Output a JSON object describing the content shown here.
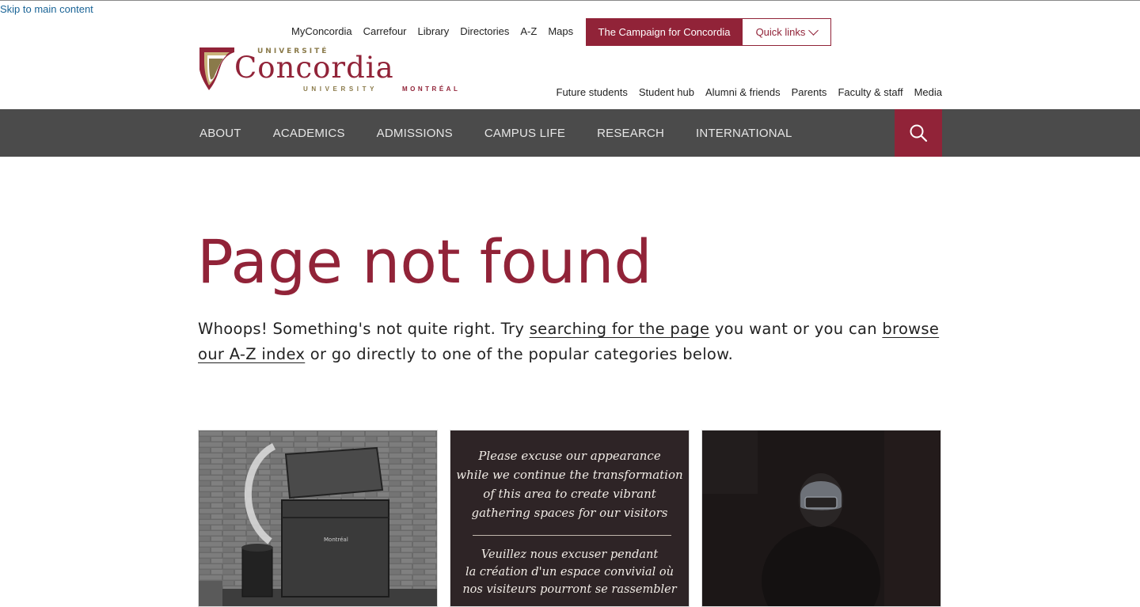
{
  "skip_link": "Skip to main content",
  "utility_nav": [
    "MyConcordia",
    "Carrefour",
    "Library",
    "Directories",
    "A-Z",
    "Maps"
  ],
  "campaign_button": "The Campaign for Concordia",
  "quick_links": "Quick links",
  "logo": {
    "univ_fr": "UNIVERSITÉ",
    "name": "Concordia",
    "univ_en": "UNIVERSITY",
    "city": "MONTRÉAL"
  },
  "audience_nav": [
    "Future students",
    "Student hub",
    "Alumni & friends",
    "Parents",
    "Faculty & staff",
    "Media"
  ],
  "main_nav": [
    "ABOUT",
    "ACADEMICS",
    "ADMISSIONS",
    "CAMPUS LIFE",
    "RESEARCH",
    "INTERNATIONAL"
  ],
  "page_title": "Page not found",
  "intro": {
    "part1": "Whoops! Something's not quite right. Try ",
    "link1": "searching for the page",
    "part2": " you want or you can ",
    "link2": "browse our A-Z index",
    "part3": " or go directly to one of the popular categories below."
  },
  "cards": {
    "sign_en": [
      "Please excuse our appearance",
      "while we continue the transformation",
      "of this area to create vibrant",
      "gathering spaces for our visitors"
    ],
    "sign_fr": [
      "Veuillez nous excuser pendant",
      "la création d'un espace convivial où",
      "nos visiteurs pourront se rassembler"
    ],
    "dumpster_label": "Montréal"
  },
  "colors": {
    "brand": "#912338",
    "nav_bg": "#4b4b4b",
    "gold": "#8a7a4a"
  }
}
